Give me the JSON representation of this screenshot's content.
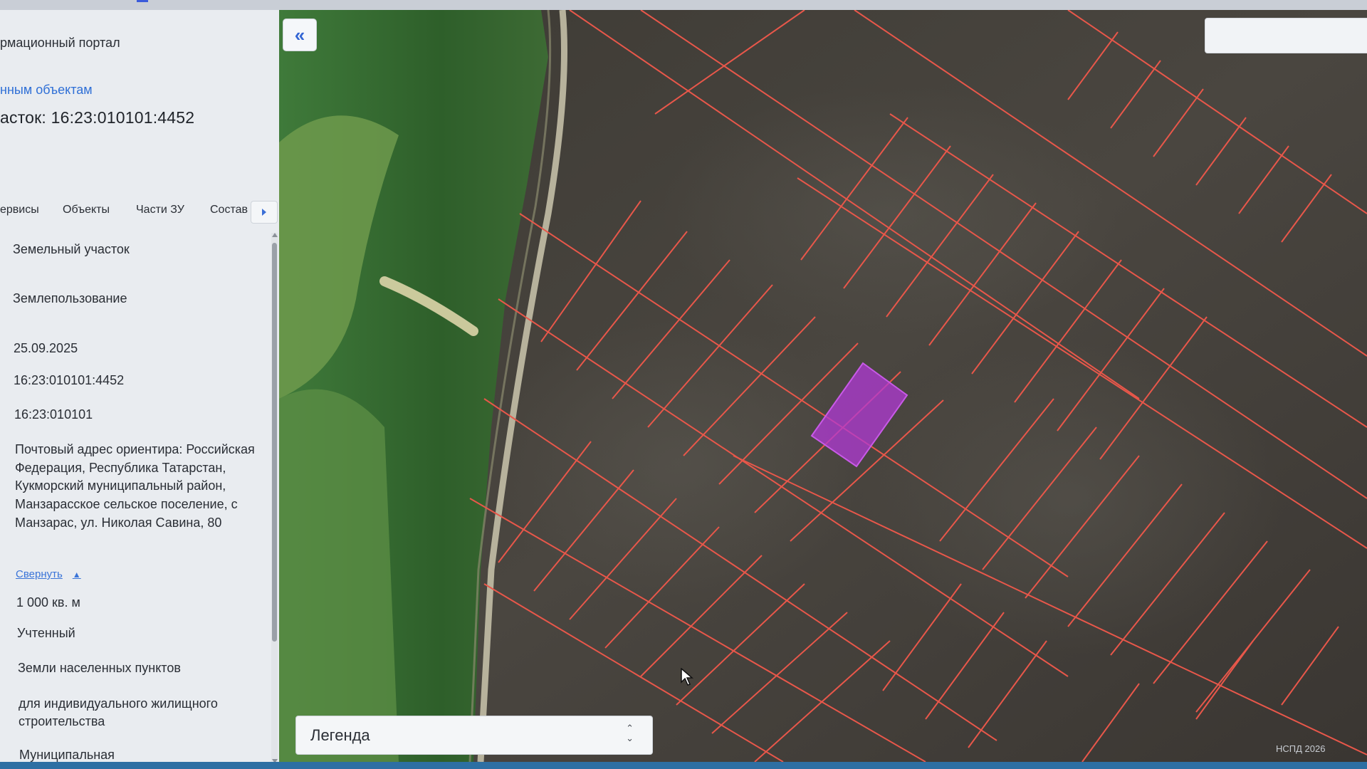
{
  "header": {
    "portal_title": "рмационный портал",
    "back_link": "нным объектам",
    "parcel_title": "асток: 16:23:010101:4452"
  },
  "tabs": [
    {
      "label": "ервисы"
    },
    {
      "label": "Объекты"
    },
    {
      "label": "Части ЗУ"
    },
    {
      "label": "Состав"
    }
  ],
  "fields": {
    "object_type": "Земельный участок",
    "subtype": "Землепользование",
    "date": "25.09.2025",
    "cadastral_number": "16:23:010101:4452",
    "cadastral_quarter": "16:23:010101",
    "address": "Почтовый адрес ориентира: Российская Федерация, Республика Татарстан, Кукморский муниципальный район, Манзарасское сельское поселение, с Манзарас, ул. Николая Савина, 80",
    "collapse_label": "Свернуть",
    "area": "1 000 кв. м",
    "status": "Учтенный",
    "land_category": "Земли населенных пунктов",
    "permitted_use": "для индивидуального жилищного строительства",
    "ownership": "Муниципальная"
  },
  "map": {
    "legend_label": "Легенда",
    "copyright": "НСПД 2026",
    "selected_parcel_color": "#b23ad6",
    "parcel_line_color": "#e8574a",
    "accent_color": "#3466d4"
  }
}
